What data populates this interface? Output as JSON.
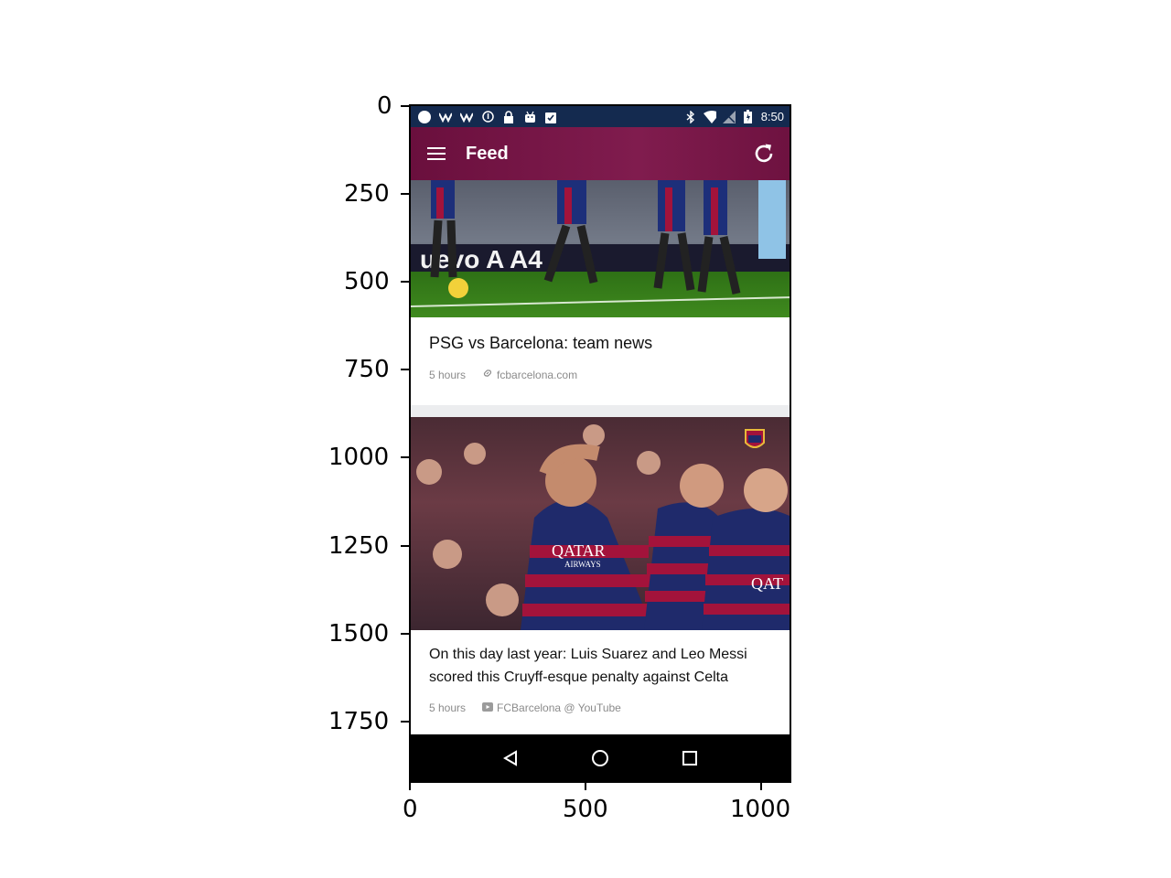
{
  "axes": {
    "y_ticks": [
      "0",
      "250",
      "500",
      "750",
      "1000",
      "1250",
      "1500",
      "1750"
    ],
    "x_ticks": [
      "0",
      "500",
      "1000"
    ]
  },
  "status_bar": {
    "time": "8:50",
    "left_icons": [
      "circle-icon",
      "signal-w-icon",
      "signal-w2-icon",
      "info-icon",
      "lock-icon",
      "android-icon",
      "clipboard-check-icon"
    ],
    "right_icons": [
      "bluetooth-icon",
      "wifi-icon",
      "no-sim-icon",
      "battery-icon"
    ]
  },
  "app_bar": {
    "title": "Feed",
    "menu_icon": "hamburger-menu-icon",
    "refresh_icon": "refresh-icon",
    "colors": {
      "start": "#6a0f3d",
      "end": "#801c4e"
    }
  },
  "feed": {
    "cards": [
      {
        "title": "PSG vs Barcelona: team news",
        "time": "5 hours",
        "source_icon": "link-icon",
        "source": "fcbarcelona.com"
      },
      {
        "title": "On this day last year: Luis Suarez and Leo Messi scored this Cruyff-esque penalty against Celta",
        "time": "5 hours",
        "source_icon": "youtube-icon",
        "source": "FCBarcelona @ YouTube"
      }
    ]
  },
  "nav_bar": {
    "buttons": [
      "back-icon",
      "home-icon",
      "recents-icon"
    ]
  }
}
